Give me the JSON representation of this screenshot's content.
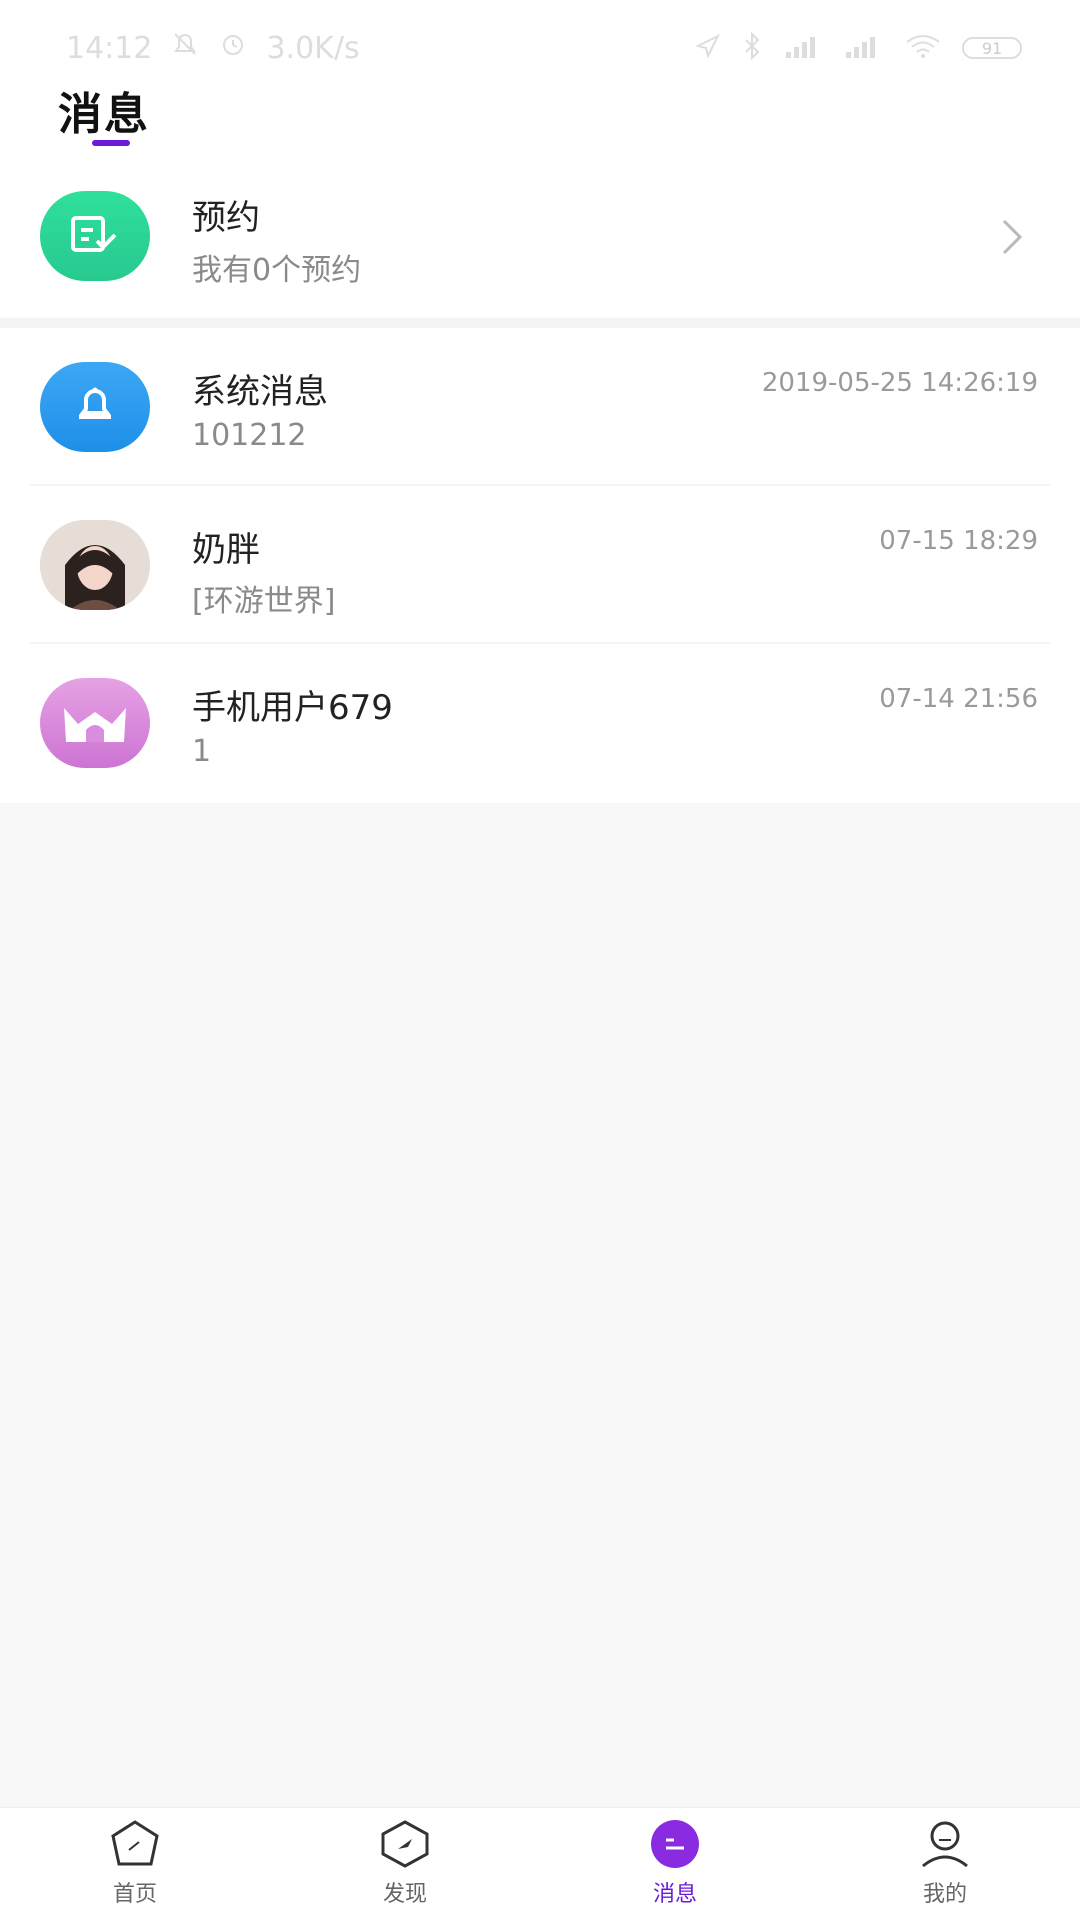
{
  "status_bar": {
    "time": "14:12",
    "speed": "3.0K/s",
    "battery": "91"
  },
  "header": {
    "title": "消息"
  },
  "reservation": {
    "title": "预约",
    "subtitle": "我有0个预约"
  },
  "messages": [
    {
      "title": "系统消息",
      "subtitle": "101212",
      "time": "2019-05-25 14:26:19",
      "avatar_icon": "bell-icon"
    },
    {
      "title": "奶胖",
      "subtitle": "[环游世界]",
      "time": "07-15 18:29",
      "avatar_icon": "user-photo-avatar"
    },
    {
      "title": "手机用户679",
      "subtitle": "1",
      "time": "07-14 21:56",
      "avatar_icon": "cat-logo-avatar"
    }
  ],
  "bottom_nav": {
    "items": [
      {
        "label": "首页",
        "icon": "home-icon",
        "active": false
      },
      {
        "label": "发现",
        "icon": "compass-icon",
        "active": false
      },
      {
        "label": "消息",
        "icon": "message-icon",
        "active": true
      },
      {
        "label": "我的",
        "icon": "profile-icon",
        "active": false
      }
    ]
  },
  "colors": {
    "accent": "#6b1bd6",
    "reservation_green": "#2fe09c",
    "system_blue": "#2d9df0",
    "cat_pink": "#d58ad8"
  }
}
